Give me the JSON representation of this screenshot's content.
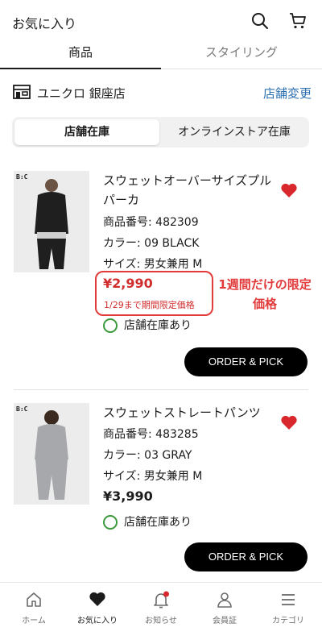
{
  "header": {
    "title": "お気に入り",
    "icons": [
      "search-icon",
      "cart-icon"
    ]
  },
  "tabs": [
    {
      "label": "商品",
      "active": true
    },
    {
      "label": "スタイリング",
      "active": false
    }
  ],
  "store": {
    "icon": "store-icon",
    "name": "ユニクロ 銀座店",
    "change_label": "店舗変更"
  },
  "segment": {
    "store_stock": "店舗在庫",
    "online_stock": "オンラインストア在庫",
    "active": "store_stock"
  },
  "products": [
    {
      "brand_badge": "B:C",
      "name": "スウェットオーバーサイズプルパーカ",
      "product_no": "商品番号: 482309",
      "color": "カラー: 09 BLACK",
      "size": "サイズ: 男女兼用 M",
      "price": "¥2,990",
      "price_color": "#d12d2d",
      "promo": "1/29まで期間限定価格",
      "stock": "店舗在庫あり",
      "order_label": "ORDER & PICK",
      "favorited": true
    },
    {
      "brand_badge": "B:C",
      "name": "スウェットストレートパンツ",
      "product_no": "商品番号: 483285",
      "color": "カラー: 03 GRAY",
      "size": "サイズ: 男女兼用 M",
      "price": "¥3,990",
      "price_color": "#1b1b1b",
      "stock": "店舗在庫あり",
      "order_label": "ORDER & PICK",
      "favorited": true
    }
  ],
  "annotation": {
    "text": "1週間だけの限定価格"
  },
  "bottom_nav": [
    {
      "label": "ホーム",
      "icon": "home-icon",
      "active": false
    },
    {
      "label": "お気に入り",
      "icon": "heart-icon",
      "active": true
    },
    {
      "label": "お知らせ",
      "icon": "bell-icon",
      "active": false,
      "badge": true
    },
    {
      "label": "会員証",
      "icon": "member-icon",
      "active": false
    },
    {
      "label": "カテゴリ",
      "icon": "menu-icon",
      "active": false
    }
  ],
  "colors": {
    "accent_red": "#e23b3b",
    "link_blue": "#2b6fb0",
    "stock_green": "#3c9a3c"
  }
}
